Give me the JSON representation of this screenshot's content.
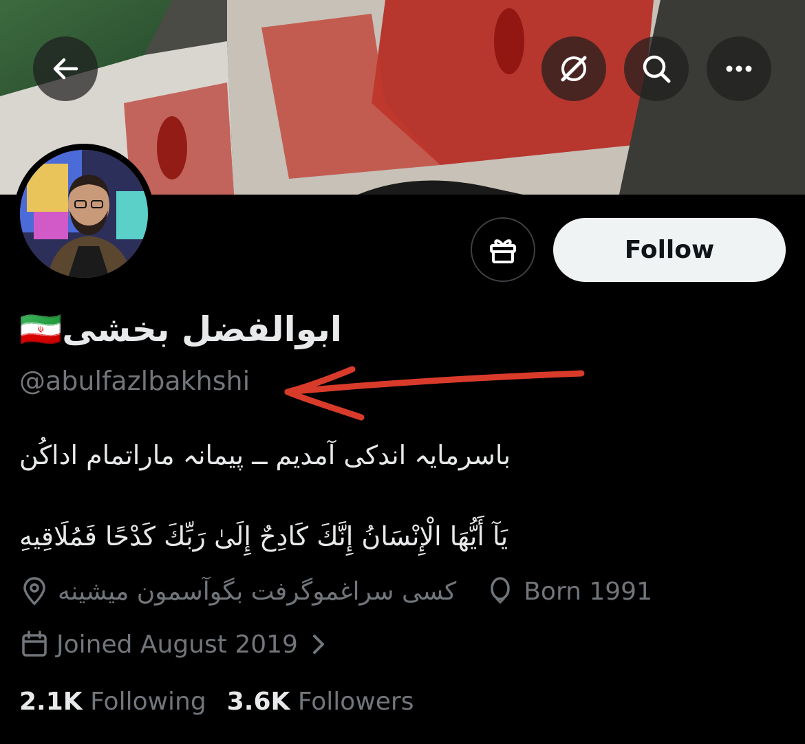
{
  "header": {
    "back_icon": "arrow-left-icon",
    "grok_icon": "grok-icon",
    "search_icon": "search-icon",
    "more_icon": "more-horizontal-icon"
  },
  "profile": {
    "display_name": "ابوالفضل بخشی🇮🇷",
    "handle": "@abulfazlbakhshi",
    "bio_line1": "باسرمایہ اندکی آمدیم ــ پیمانہ ماراتمام اداکُن",
    "bio_line2": "يَآ أَيُّهَا الْإِنْسَانُ إِنَّكَ كَادِحٌ إِلَىٰ رَبِّكَ كَدْحًا فَمُلَاقِيهِ",
    "location": "کسی سراغموگرفت بگوآسمون میشینه",
    "birth": "Born 1991",
    "joined": "Joined August 2019"
  },
  "actions": {
    "follow_label": "Follow",
    "gift_icon": "gift-icon"
  },
  "stats": {
    "following_count": "2.1K",
    "following_label": "Following",
    "followers_count": "3.6K",
    "followers_label": "Followers"
  },
  "colors": {
    "background": "#000000",
    "primary_text": "#e7e9ea",
    "secondary_text": "#71767b",
    "annotation_arrow": "#d93b2b"
  }
}
